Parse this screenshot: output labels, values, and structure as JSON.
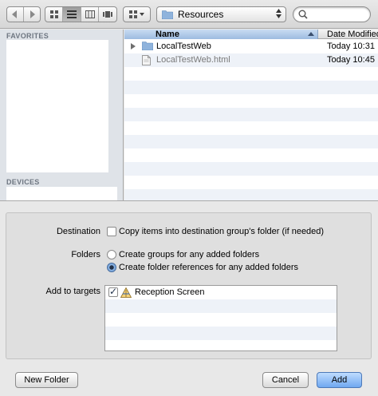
{
  "toolbar": {
    "location": "Resources",
    "search_value": "",
    "search_placeholder": ""
  },
  "sidebar": {
    "favorites_header": "FAVORITES",
    "devices_header": "DEVICES"
  },
  "file_list": {
    "columns": {
      "name": "Name",
      "date": "Date Modified"
    },
    "rows": [
      {
        "name": "LocalTestWeb",
        "date": "Today 10:31",
        "kind": "folder"
      },
      {
        "name": "LocalTestWeb.html",
        "date": "Today 10:45",
        "kind": "file"
      }
    ]
  },
  "options": {
    "destination_label": "Destination",
    "copy_items_text": "Copy items into destination group's folder (if needed)",
    "folders_label": "Folders",
    "create_groups_text": "Create groups for any added folders",
    "create_refs_text": "Create folder references for any added folders",
    "targets_label": "Add to targets",
    "targets": [
      {
        "name": "Reception Screen",
        "checked": true
      }
    ]
  },
  "buttons": {
    "new_folder": "New Folder",
    "cancel": "Cancel",
    "add": "Add"
  },
  "colors": {
    "accent": "#6fa8f0",
    "sidebar_bg": "#dfe3e8",
    "folder_blue": "#8fb3dc"
  }
}
